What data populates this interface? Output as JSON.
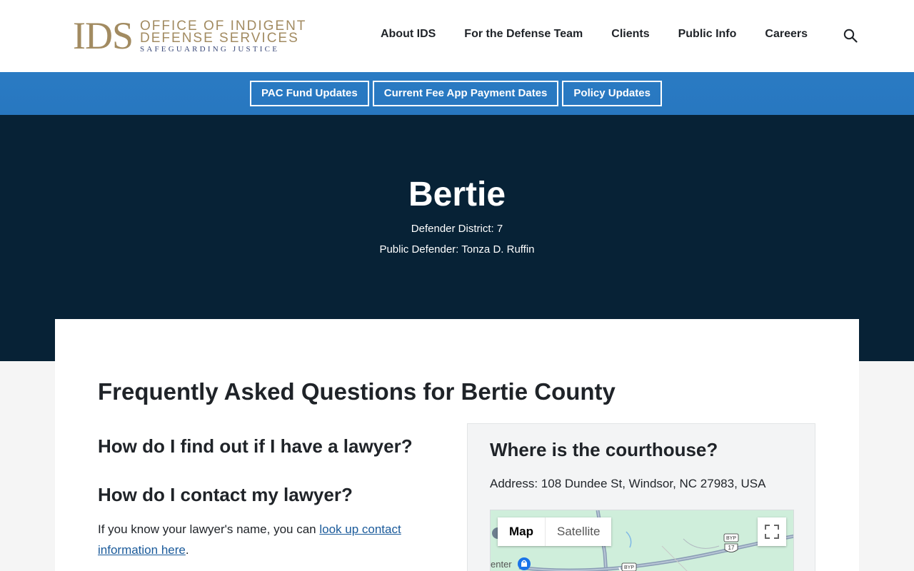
{
  "header": {
    "logo": {
      "abbr": "IDS",
      "line1": "OFFICE OF INDIGENT",
      "line2": "DEFENSE SERVICES",
      "line3": "SAFEGUARDING JUSTICE"
    },
    "nav": [
      {
        "label": "About IDS"
      },
      {
        "label": "For the Defense Team"
      },
      {
        "label": "Clients"
      },
      {
        "label": "Public Info"
      },
      {
        "label": "Careers"
      }
    ],
    "search_icon": "search-icon"
  },
  "strip": {
    "buttons": [
      {
        "label": "PAC Fund Updates"
      },
      {
        "label": "Current Fee App Payment Dates"
      },
      {
        "label": "Policy Updates"
      }
    ]
  },
  "hero": {
    "title": "Bertie",
    "district": "Defender District: 7",
    "defender": "Public Defender: Tonza D. Ruffin"
  },
  "content": {
    "faq_title": "Frequently Asked Questions for Bertie County",
    "q1": "How do I find out if I have a lawyer?",
    "q2": "How do I contact my lawyer?",
    "answer_prefix": "If you know your lawyer's name, you can ",
    "answer_link": "look up contact information here",
    "answer_suffix": "."
  },
  "courthouse": {
    "title": "Where is the courthouse?",
    "address": "Address: 108 Dundee St, Windsor, NC 27983, USA",
    "map": {
      "tab_map": "Map",
      "tab_satellite": "Satellite",
      "label_center": "enter",
      "route_badge_1": "BYP",
      "route_badge_2": "17",
      "route_badge_3": "BYP"
    }
  },
  "colors": {
    "logo_gold": "#a28b61",
    "logo_navy": "#3b4a7a",
    "strip_blue": "#2877c0",
    "hero_navy": "#072236",
    "link_blue": "#1a5a9a"
  }
}
